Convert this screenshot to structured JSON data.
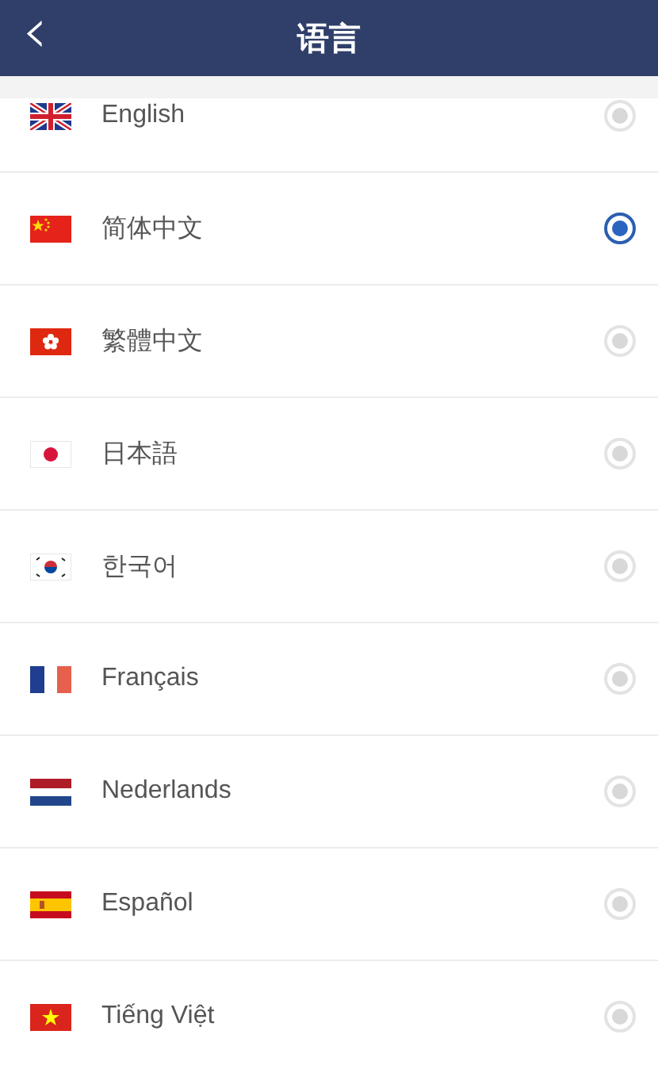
{
  "header": {
    "back_icon": "‹",
    "title": "语言"
  },
  "languages": [
    {
      "kind": "gb",
      "label": "English",
      "selected": false
    },
    {
      "kind": "cn",
      "label": "简体中文",
      "selected": true
    },
    {
      "kind": "hk",
      "label": "繁體中文",
      "selected": false
    },
    {
      "kind": "jp",
      "label": "日本語",
      "selected": false
    },
    {
      "kind": "kr",
      "label": "한국어",
      "selected": false
    },
    {
      "kind": "fr",
      "label": "Français",
      "selected": false
    },
    {
      "kind": "nl",
      "label": "Nederlands",
      "selected": false
    },
    {
      "kind": "es",
      "label": "Español",
      "selected": false
    },
    {
      "kind": "vn",
      "label": "Tiếng Việt",
      "selected": false
    }
  ]
}
